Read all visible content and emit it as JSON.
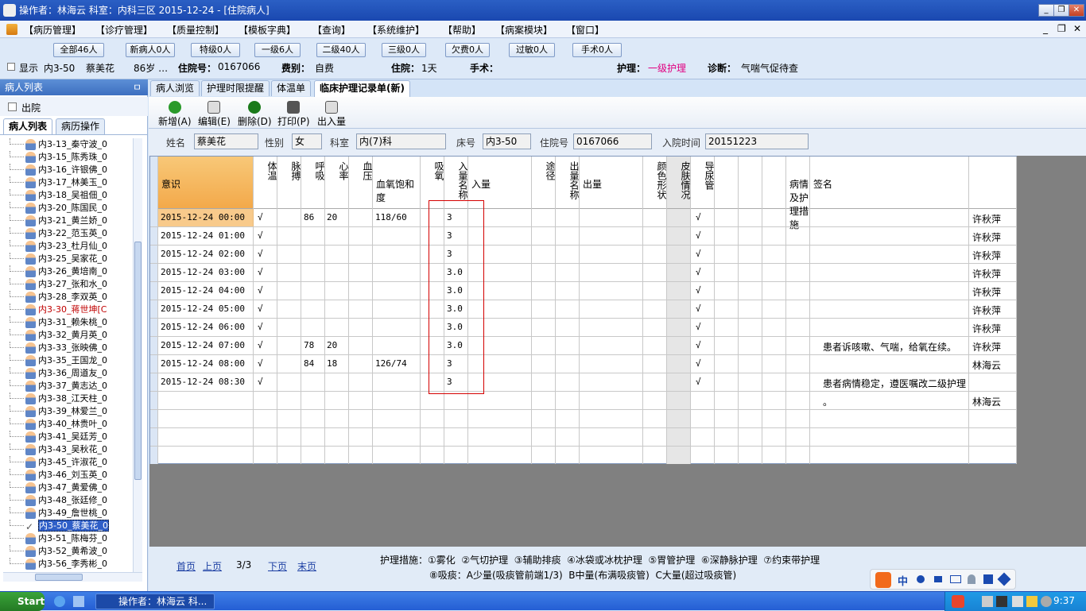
{
  "window": {
    "title": "操作者：林海云  科室：内科三区  2015-12-24 - [住院病人]",
    "controls": [
      "_",
      "❐",
      "✕"
    ]
  },
  "menu": {
    "items": [
      "【病历管理】",
      "【诊疗管理】",
      "【质量控制】",
      "【模板字典】",
      "【查询】",
      "【系统维护】",
      "【帮助】",
      "【病案模块】",
      "【窗口】"
    ],
    "window_controls": [
      "_",
      "❐",
      "✕"
    ]
  },
  "filter": {
    "buttons": [
      "全部46人",
      "新病人0人",
      "特级0人",
      "一级6人",
      "二级40人",
      "三级0人",
      "欠费0人",
      "过敏0人",
      "手术0人"
    ],
    "show_label": "显示",
    "bed": "内3-50",
    "name": "蔡美花",
    "age": "86岁 …",
    "admission_no_label": "住院号：",
    "admission_no": "0167066",
    "fee_label": "费别：",
    "fee": "自费",
    "stay_label": "住院：",
    "stay": "1天",
    "surgery_label": "手术：",
    "nursing_label": "护理：",
    "nursing": "一级护理",
    "diagnosis_label": "诊断：",
    "diagnosis": "气喘气促待查"
  },
  "left": {
    "header": "病人列表",
    "pin": "ㅁ",
    "discharged": "出院",
    "tabs": [
      "病人列表",
      "病历操作"
    ],
    "patients": [
      {
        "t": "内3-13_秦守波_0",
        "s": ""
      },
      {
        "t": "内3-15_陈秀珠_0",
        "s": ""
      },
      {
        "t": "内3-16_许银佛_0",
        "s": ""
      },
      {
        "t": "内3-17_林美玉_0",
        "s": ""
      },
      {
        "t": "内3-18_吴祖佃_0",
        "s": ""
      },
      {
        "t": "内3-20_陈国民_0",
        "s": ""
      },
      {
        "t": "内3-21_黄兰娇_0",
        "s": ""
      },
      {
        "t": "内3-22_范玉英_0",
        "s": ""
      },
      {
        "t": "内3-23_杜月仙_0",
        "s": ""
      },
      {
        "t": "内3-25_吴家花_0",
        "s": ""
      },
      {
        "t": "内3-26_黄培南_0",
        "s": ""
      },
      {
        "t": "内3-27_张和水_0",
        "s": ""
      },
      {
        "t": "内3-28_李双英_0",
        "s": ""
      },
      {
        "t": "内3-30_蒋世坤[C",
        "s": "red"
      },
      {
        "t": "内3-31_赖朱桃_0",
        "s": ""
      },
      {
        "t": "内3-32_黄月英_0",
        "s": ""
      },
      {
        "t": "内3-33_张映佛_0",
        "s": ""
      },
      {
        "t": "内3-35_王国龙_0",
        "s": ""
      },
      {
        "t": "内3-36_周道友_0",
        "s": ""
      },
      {
        "t": "内3-37_黄志达_0",
        "s": ""
      },
      {
        "t": "内3-38_江天柱_0",
        "s": ""
      },
      {
        "t": "内3-39_林爱兰_0",
        "s": ""
      },
      {
        "t": "内3-40_林贵叶_0",
        "s": ""
      },
      {
        "t": "内3-41_吴廷芳_0",
        "s": ""
      },
      {
        "t": "内3-43_吴秋花_0",
        "s": ""
      },
      {
        "t": "内3-45_许淑花_0",
        "s": ""
      },
      {
        "t": "内3-46_刘玉英_0",
        "s": ""
      },
      {
        "t": "内3-47_黄爱佛_0",
        "s": ""
      },
      {
        "t": "内3-48_张廷修_0",
        "s": ""
      },
      {
        "t": "内3-49_詹世桃_0",
        "s": ""
      },
      {
        "t": "内3-50_蔡美花_0",
        "s": "sel"
      },
      {
        "t": "内3-51_陈梅芬_0",
        "s": ""
      },
      {
        "t": "内3-52_黄希波_0",
        "s": ""
      },
      {
        "t": "内3-56_李秀彬_0",
        "s": ""
      }
    ]
  },
  "tabs": [
    "病人浏览",
    "护理时限提醒",
    "体温单",
    "临床护理记录单(新)"
  ],
  "toolbar": [
    "新增(A)",
    "编辑(E)",
    "删除(D)",
    "打印(P)",
    "出入量"
  ],
  "patient": {
    "name_label": "姓名",
    "name": "蔡美花",
    "sex_label": "性别",
    "sex": "女",
    "dept_label": "科室",
    "dept": "内(7)科",
    "bed_label": "床号",
    "bed": "内3-50",
    "adm_label": "住院号",
    "adm": "0167066",
    "date_label": "入院时间",
    "date": "20151223"
  },
  "grid": {
    "headers": [
      "",
      "意识",
      "体温",
      "脉搏",
      "呼吸",
      "心率",
      "血压",
      "血氧饱和度",
      "吸氧",
      "入量名称",
      "入量",
      "途径",
      "出量名称",
      "出量",
      "颜色形状",
      "皮肤情况",
      "导尿管",
      "",
      "",
      "",
      "病情及护理措施",
      "签名"
    ],
    "rows": [
      {
        "time": "2015-12-24 00:00",
        "c": "√",
        "p": "86",
        "r": "20",
        "bp": "118/60",
        "o2": "3",
        "skin": "√",
        "note": "",
        "sig": "许秋萍"
      },
      {
        "time": "2015-12-24 01:00",
        "c": "√",
        "p": "",
        "r": "",
        "bp": "",
        "o2": "3",
        "skin": "√",
        "note": "",
        "sig": "许秋萍"
      },
      {
        "time": "2015-12-24 02:00",
        "c": "√",
        "p": "",
        "r": "",
        "bp": "",
        "o2": "3",
        "skin": "√",
        "note": "",
        "sig": "许秋萍"
      },
      {
        "time": "2015-12-24 03:00",
        "c": "√",
        "p": "",
        "r": "",
        "bp": "",
        "o2": "3.0",
        "skin": "√",
        "note": "",
        "sig": "许秋萍"
      },
      {
        "time": "2015-12-24 04:00",
        "c": "√",
        "p": "",
        "r": "",
        "bp": "",
        "o2": "3.0",
        "skin": "√",
        "note": "",
        "sig": "许秋萍"
      },
      {
        "time": "2015-12-24 05:00",
        "c": "√",
        "p": "",
        "r": "",
        "bp": "",
        "o2": "3.0",
        "skin": "√",
        "note": "",
        "sig": "许秋萍"
      },
      {
        "time": "2015-12-24 06:00",
        "c": "√",
        "p": "",
        "r": "",
        "bp": "",
        "o2": "3.0",
        "skin": "√",
        "note": "",
        "sig": "许秋萍"
      },
      {
        "time": "2015-12-24 07:00",
        "c": "√",
        "p": "78",
        "r": "20",
        "bp": "",
        "o2": "3.0",
        "skin": "√",
        "note": "患者诉咳嗽、气喘，给氧在续。",
        "sig": "许秋萍"
      },
      {
        "time": "2015-12-24 08:00",
        "c": "√",
        "p": "84",
        "r": "18",
        "bp": "126/74",
        "o2": "3",
        "skin": "√",
        "note": "",
        "sig": "林海云"
      },
      {
        "time": "2015-12-24 08:30",
        "c": "√",
        "p": "",
        "r": "",
        "bp": "",
        "o2": "3",
        "skin": "√",
        "note": "患者病情稳定，遵医嘱改二级护理",
        "sig": ""
      },
      {
        "time": "",
        "c": "",
        "p": "",
        "r": "",
        "bp": "",
        "o2": "",
        "skin": "",
        "note": "。",
        "sig": "林海云"
      },
      {
        "time": "",
        "c": "",
        "p": "",
        "r": "",
        "bp": "",
        "o2": "",
        "skin": "",
        "note": "",
        "sig": ""
      },
      {
        "time": "",
        "c": "",
        "p": "",
        "r": "",
        "bp": "",
        "o2": "",
        "skin": "",
        "note": "",
        "sig": ""
      },
      {
        "time": "",
        "c": "",
        "p": "",
        "r": "",
        "bp": "",
        "o2": "",
        "skin": "",
        "note": "",
        "sig": ""
      }
    ]
  },
  "pager": {
    "first": "首页",
    "prev": "上页",
    "page": "3/3",
    "next": "下页",
    "last": "末页"
  },
  "legend": {
    "line1": "护理措施：①雾化  ②气切护理  ③辅助排痰  ④冰袋或冰枕护理  ⑤胃管护理  ⑥深静脉护理  ⑦约束带护理",
    "line2": "⑧吸痰：A少量(吸痰管前端1/3)  B中量(布满吸痰管)  C大量(超过吸痰管)"
  },
  "taskbar": {
    "start": "Start",
    "item": "操作者：林海云  科...",
    "clock": "9:37",
    "ime": "中"
  },
  "colors": {
    "title": "#2b5fc4",
    "nursing_text": "#e00080",
    "red_box": "#d40000",
    "time_highlight": "#f5b45a"
  }
}
